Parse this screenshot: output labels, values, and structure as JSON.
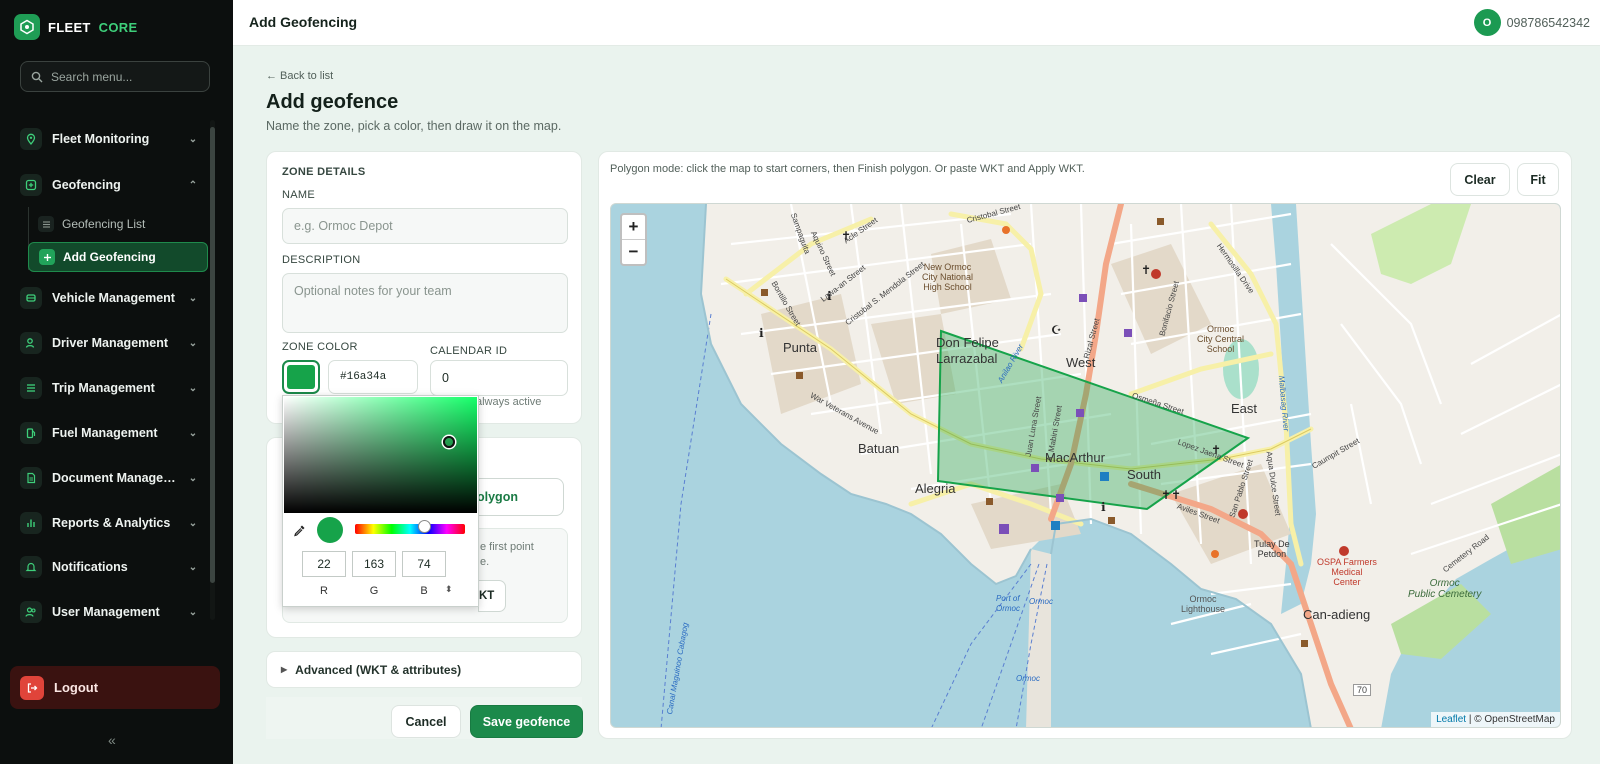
{
  "brand": {
    "name": "FLEET",
    "accent": "CORE"
  },
  "sidebar": {
    "search_placeholder": "Search menu...",
    "items": [
      {
        "label": "Fleet Monitoring"
      },
      {
        "label": "Geofencing"
      },
      {
        "label": "Vehicle Management"
      },
      {
        "label": "Driver Management"
      },
      {
        "label": "Trip Management"
      },
      {
        "label": "Fuel Management"
      },
      {
        "label": "Document Managem..."
      },
      {
        "label": "Reports & Analytics"
      },
      {
        "label": "Notifications"
      },
      {
        "label": "User Management"
      }
    ],
    "geofencing_sub": [
      {
        "label": "Geofencing List"
      },
      {
        "label": "Add Geofencing"
      }
    ],
    "logout": "Logout"
  },
  "topbar": {
    "title": "Add Geofencing",
    "user_initial": "O",
    "user_phone": "098786542342"
  },
  "page": {
    "back_link": "← Back to list",
    "title": "Add geofence",
    "subtitle": "Name the zone, pick a color, then draw it on the map."
  },
  "form": {
    "section_title": "ZONE DETAILS",
    "name_label": "NAME",
    "name_placeholder": "e.g. Ormoc Depot",
    "description_label": "DESCRIPTION",
    "description_placeholder": "Optional notes for your team",
    "color_label": "ZONE COLOR",
    "color_hex": "#16a34a",
    "calendar_label": "CALENDAR ID",
    "calendar_value": "0",
    "calendar_hint": "always active",
    "draw_mode": "olygon",
    "instruction_line1": "e first point",
    "instruction_line2": "e.",
    "wkt_button": "KT",
    "advanced_label": "Advanced (WKT & attributes)",
    "cancel": "Cancel",
    "save": "Save geofence"
  },
  "color_picker": {
    "r": "22",
    "g": "163",
    "b": "74",
    "r_label": "R",
    "g_label": "G",
    "b_label": "B",
    "swatch_color": "#16a34a"
  },
  "map": {
    "hint": "Polygon mode: click the map to start corners, then Finish polygon. Or paste WKT and Apply WKT.",
    "clear": "Clear",
    "fit": "Fit",
    "zoom_in": "+",
    "zoom_out": "−",
    "attribution_leaflet": "Leaflet",
    "attribution_rest": " | © OpenStreetMap",
    "labels": {
      "punta": "Punta",
      "batuan": "Batuan",
      "alegria": "Alegria",
      "don_felipe_1": "Don Felipe",
      "don_felipe_2": "Larrazabal",
      "west": "West",
      "east": "East",
      "macarthur": "MacArthur",
      "south": "South",
      "can_adieng": "Can-adieng",
      "school1": "New Ormoc\nCity National\nHigh School",
      "school2": "Ormoc\nCity Central\nSchool",
      "hospital": "OSPA Farmers\nMedical\nCenter",
      "cemetery": "Ormoc\nPublic Cemetery",
      "cemetery_road": "Cemetery Road",
      "lighthouse": "Ormoc\nLighthouse",
      "tulay": "Tulay De\nPetdon",
      "port_of": "Port of",
      "port_ormoc": "Ormoc",
      "ormoc1": "Ormoc",
      "ormoc2": "Ormoc",
      "route": "70",
      "war_veterans": "War Veterans Avenue",
      "osmena": "Osmeña Street",
      "aviles": "Aviles Street",
      "lopez_jaena": "Lopez Jaena Street",
      "rizal": "Rizal Street",
      "aqua_dulce": "Aqua Dulce Street",
      "hermosilla": "Hermosilla Drive",
      "malbasag": "Malbasag River",
      "anilao": "Anilao River",
      "lilia": "Juan Luna Street",
      "mabini": "A. Mabini Street",
      "bonifacio": "Bonifacio Street",
      "san_pablo": "San Pablo Street",
      "caumpit": "Caumpit Street",
      "acle": "Acle Street",
      "aquino": "Aquino Street",
      "saint_1": "Cristobal Street",
      "mendola": "Cristobal S. Mendola Street",
      "burgos": "Bontillo Street",
      "lawa": "Lawa-an Street",
      "sampaguita": "Sampaguita",
      "canal": "Canal Maguinoo Cabagog"
    }
  },
  "colors": {
    "accent": "#1c8a4b",
    "polygon": "#16a34a",
    "logout": "#e0443a"
  }
}
